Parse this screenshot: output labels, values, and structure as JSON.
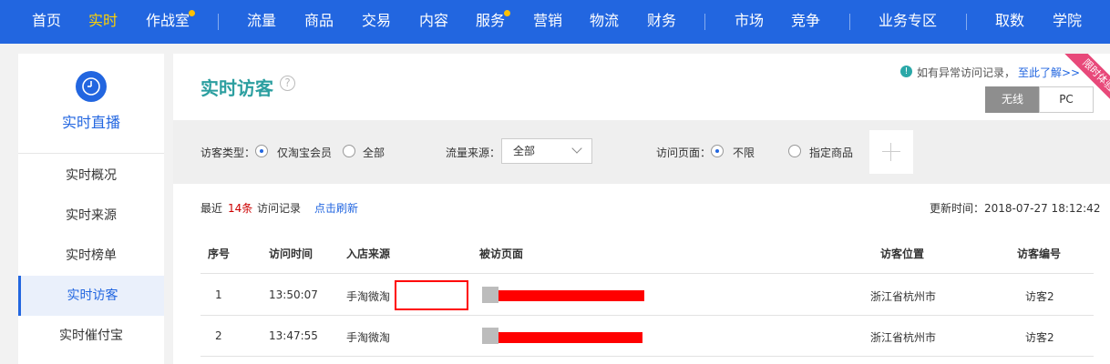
{
  "topnav": {
    "items": [
      "首页",
      "实时",
      "作战室",
      "流量",
      "商品",
      "交易",
      "内容",
      "服务",
      "营销",
      "物流",
      "财务",
      "市场",
      "竞争",
      "业务专区",
      "取数",
      "学院"
    ],
    "active": "实时"
  },
  "sidebar": {
    "title": "实时直播",
    "logo_icon": "clock-icon",
    "items": [
      "实时概况",
      "实时来源",
      "实时榜单",
      "实时访客",
      "实时催付宝"
    ],
    "active": "实时访客"
  },
  "main": {
    "title": "实时访客",
    "help_icon": "question-icon",
    "notice": {
      "icon": "info-icon",
      "text": "如有异常访问记录，",
      "link": "至此了解>>"
    },
    "ribbon": "限时体验",
    "device_toggle": [
      "无线",
      "PC"
    ],
    "device_active": "无线"
  },
  "filters": {
    "visitor_type_label": "访客类型：",
    "visitor_type_options": [
      "仅淘宝会员",
      "全部"
    ],
    "visitor_type_selected": "仅淘宝会员",
    "source_label": "流量来源：",
    "source_value": "全部",
    "page_label": "访问页面：",
    "page_options": [
      "不限",
      "指定商品"
    ],
    "page_selected": "不限",
    "add_icon": "plus-icon"
  },
  "records": {
    "prefix": "最近",
    "count": "14条",
    "suffix": "访问记录",
    "refresh": "点击刷新",
    "updated": "更新时间：2018-07-27 18:12:42"
  },
  "table": {
    "headers": [
      "序号",
      "访问时间",
      "入店来源",
      "被访页面",
      "访客位置",
      "访客编号"
    ],
    "rows": [
      {
        "no": "1",
        "time": "13:50:07",
        "source": "手淘微淘",
        "location": "浙江省杭州市",
        "visitor": "访客2"
      },
      {
        "no": "2",
        "time": "13:47:55",
        "source": "手淘微淘",
        "location": "浙江省杭州市",
        "visitor": "访客2"
      }
    ]
  },
  "colors": {
    "nav_bg": "#2266e0",
    "nav_active": "#ffd200",
    "title_teal": "#2c9fa0",
    "count_red": "#cc0000",
    "link_blue": "#2266e0",
    "redaction": "#ff0000"
  }
}
